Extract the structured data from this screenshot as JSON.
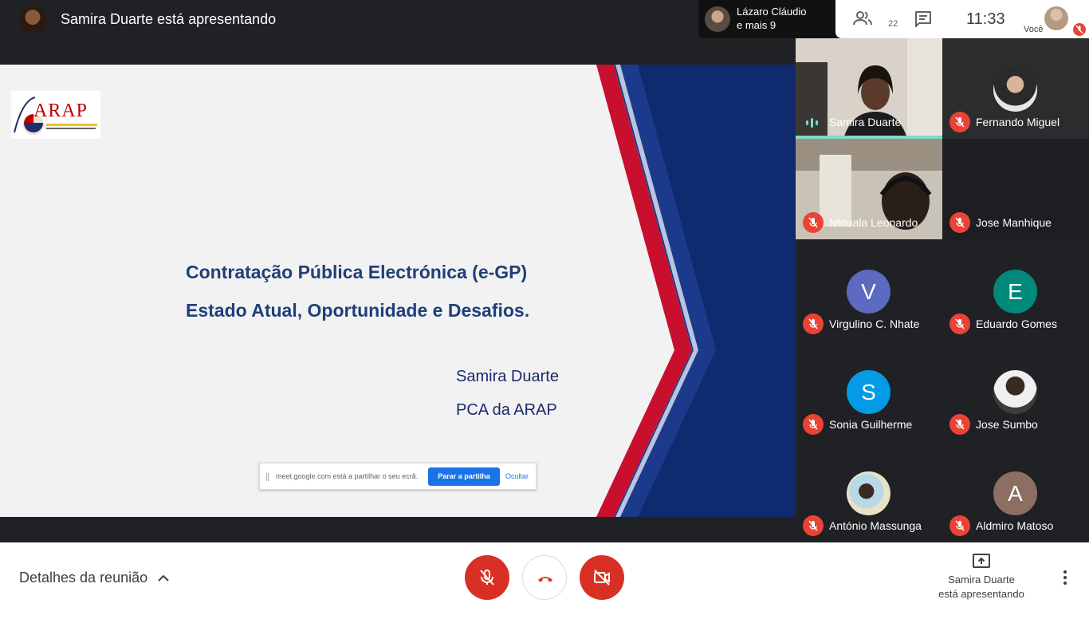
{
  "header": {
    "presenter_title": "Samira Duarte está apresentando",
    "participants_chip": {
      "line1": "Lázaro Cláudio",
      "line2": "e mais 9"
    },
    "people_count": "22",
    "time": "11:33",
    "you_label": "Você"
  },
  "slide": {
    "logo_text": "ARAP",
    "title_line1": "Contratação Pública Electrónica (e-GP)",
    "title_line2": "Estado Atual, Oportunidade e Desafios.",
    "author": "Samira Duarte",
    "role": "PCA da ARAP"
  },
  "share_bar": {
    "message": "meet.google.com está a partilhar o seu ecrã.",
    "stop_label": "Parar a partilha",
    "hide_label": "Ocultar"
  },
  "tiles": [
    {
      "name": "Samira Duarte",
      "type": "video",
      "speaking": true
    },
    {
      "name": "Fernando Miguel",
      "type": "photo",
      "muted": true
    },
    {
      "name": "Ntouala Leonardo",
      "type": "video",
      "muted": true
    },
    {
      "name": "Jose Manhique",
      "type": "blank",
      "muted": true
    },
    {
      "name": "Virgulino C. Nhate",
      "type": "letter",
      "letter": "V",
      "color": "#5c6bc0",
      "muted": true
    },
    {
      "name": "Eduardo Gomes",
      "type": "letter",
      "letter": "E",
      "color": "#00897b",
      "muted": true
    },
    {
      "name": "Sonia Guilherme",
      "type": "letter",
      "letter": "S",
      "color": "#039be5",
      "muted": true
    },
    {
      "name": "Jose Sumbo",
      "type": "photo",
      "muted": true
    },
    {
      "name": "António Massunga",
      "type": "photo",
      "muted": true
    },
    {
      "name": "Aldmiro Matoso",
      "type": "letter",
      "letter": "A",
      "color": "#8d6e63",
      "muted": true
    }
  ],
  "footer": {
    "details_label": "Detalhes da reunião",
    "presenting_line1": "Samira Duarte",
    "presenting_line2": "está apresentando"
  },
  "icons": {
    "mic_off": "mic-off-icon",
    "hang_up": "hang-up-icon",
    "camera_off": "camera-off-icon",
    "people": "people-icon",
    "chat": "chat-icon",
    "present": "present-icon",
    "more": "more-vert-icon"
  },
  "colors": {
    "accent_red": "#d93025",
    "mute_red": "#ea4335",
    "slide_title_blue": "#1f3f7a",
    "share_blue": "#1a73e8",
    "speaking_teal": "#81d8c8"
  }
}
